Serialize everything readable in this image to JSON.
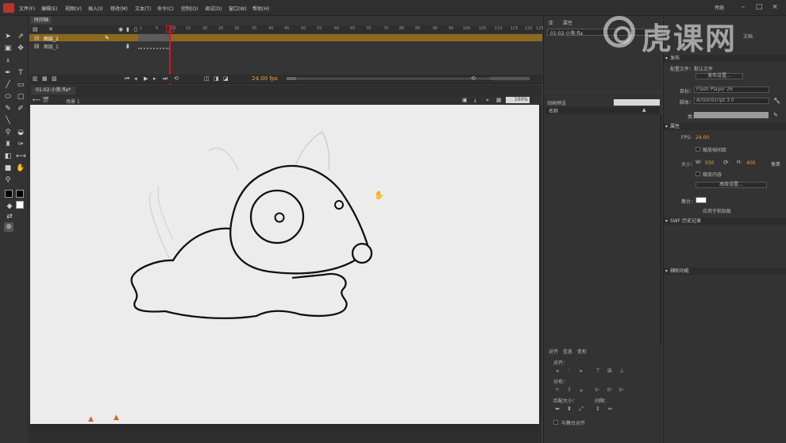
{
  "menubar": {
    "items": [
      "文件(F)",
      "编辑(E)",
      "视图(V)",
      "插入(I)",
      "修改(M)",
      "文本(T)",
      "命令(C)",
      "控制(O)",
      "调试(D)",
      "窗口(W)",
      "帮助(H)"
    ],
    "workspace": "传统"
  },
  "watermark": {
    "text": "虎课网"
  },
  "timeline": {
    "tab": "时间轴",
    "ruler": [
      "1",
      "5",
      "10",
      "15",
      "20",
      "25",
      "30",
      "35",
      "40",
      "45",
      "50",
      "55",
      "60",
      "65",
      "70",
      "75",
      "80",
      "85",
      "90",
      "95",
      "100",
      "105",
      "110",
      "115",
      "120",
      "125"
    ],
    "layers": [
      {
        "name": "图层_2",
        "selected": true
      },
      {
        "name": "图层_1",
        "selected": false
      }
    ],
    "fps": "24.00 fps"
  },
  "document": {
    "tab": "01-02-小狗.fla*",
    "scene": "场景 1",
    "zoom": "100%"
  },
  "library": {
    "tab1": "库",
    "tab2": "属性",
    "file": "01-02-小狗.fla"
  },
  "motion": {
    "tab": "动画预设",
    "column": "名称"
  },
  "align": {
    "tabs": [
      "对齐",
      "信息",
      "变形"
    ],
    "align_label": "对齐：",
    "distribute_label": "分布：",
    "match_label": "匹配大小：",
    "space_label": "间隔：",
    "to_stage": "与舞台对齐"
  },
  "properties": {
    "doc_title": "文档",
    "section_publish": "发布",
    "profile_label": "配置文件：",
    "profile_value": "默认文件",
    "publish_settings": "发布设置...",
    "target_label": "目标：",
    "target_value": "Flash Player 26",
    "script_label": "脚本：",
    "script_value": "ActionScript 3.0",
    "class_label": "类：",
    "section_props": "属性",
    "fps_label": "FPS:",
    "fps_value": "24.00",
    "scale_frames": "缩放帧间距",
    "size_label": "大小：",
    "width": "550",
    "height": "400",
    "px": "像素",
    "scale_content": "缩放内容",
    "advanced": "高级设置...",
    "stage_label": "舞台：",
    "apply_parent": "应用于粘贴板",
    "section_swf": "SWF 历史记录",
    "section_accessibility": "辅助功能"
  },
  "colors": {
    "accent": "#e8a33a",
    "playhead": "#dd1122",
    "stage": "#ececec"
  }
}
